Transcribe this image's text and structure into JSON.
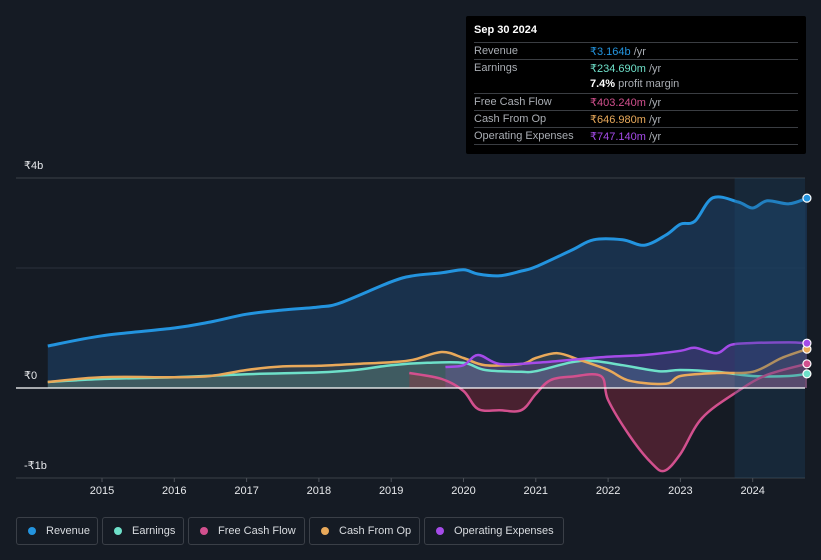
{
  "tooltip": {
    "date": "Sep 30 2024",
    "rows": [
      {
        "label": "Revenue",
        "value": "₹3.164b",
        "unit": " /yr",
        "color": "#2394df"
      },
      {
        "label": "Earnings",
        "value": "₹234.690m",
        "unit": " /yr",
        "color": "#6ee0c9"
      },
      {
        "label": "",
        "value": "7.4%",
        "unit": " profit margin",
        "color": "#ffffff"
      },
      {
        "label": "Free Cash Flow",
        "value": "₹403.240m",
        "unit": " /yr",
        "color": "#d2508e"
      },
      {
        "label": "Cash From Op",
        "value": "₹646.980m",
        "unit": " /yr",
        "color": "#e9a95a"
      },
      {
        "label": "Operating Expenses",
        "value": "₹747.140m",
        "unit": " /yr",
        "color": "#a54be9"
      }
    ]
  },
  "legend": [
    {
      "label": "Revenue",
      "color": "#2394df"
    },
    {
      "label": "Earnings",
      "color": "#6ee0c9"
    },
    {
      "label": "Free Cash Flow",
      "color": "#d2508e"
    },
    {
      "label": "Cash From Op",
      "color": "#e9a95a"
    },
    {
      "label": "Operating Expenses",
      "color": "#a54be9"
    }
  ],
  "chart_data": {
    "type": "area",
    "title": "",
    "xlabel": "",
    "ylabel": "",
    "y_tick_labels": [
      "₹4b",
      "₹0",
      "-₹1b"
    ],
    "x_tick_labels": [
      "2015",
      "2016",
      "2017",
      "2018",
      "2019",
      "2020",
      "2021",
      "2022",
      "2023",
      "2024"
    ],
    "x_ticks": [
      2015,
      2016,
      2017,
      2018,
      2019,
      2020,
      2021,
      2022,
      2023,
      2024
    ],
    "xlim": [
      2014.25,
      2024.75
    ],
    "ylim": [
      -1.5,
      3.5
    ],
    "units": "₹ billions",
    "highlight_start": 2023.75,
    "grid": true,
    "legend_position": "bottom",
    "series": [
      {
        "name": "Revenue",
        "color": "#2394df",
        "x": [
          2014.25,
          2015,
          2016,
          2016.5,
          2017,
          2017.5,
          2018,
          2018.3,
          2019,
          2019.3,
          2019.7,
          2020,
          2020.2,
          2020.5,
          2020.8,
          2021,
          2021.5,
          2021.8,
          2022.2,
          2022.5,
          2022.8,
          2023,
          2023.2,
          2023.45,
          2023.8,
          2024,
          2024.2,
          2024.5,
          2024.75
        ],
        "y": [
          0.7,
          0.87,
          1.0,
          1.1,
          1.23,
          1.3,
          1.35,
          1.42,
          1.77,
          1.87,
          1.92,
          1.97,
          1.9,
          1.87,
          1.95,
          2.02,
          2.3,
          2.47,
          2.47,
          2.38,
          2.55,
          2.73,
          2.78,
          3.17,
          3.1,
          3.0,
          3.12,
          3.07,
          3.164
        ]
      },
      {
        "name": "Earnings",
        "color": "#6ee0c9",
        "x": [
          2014.25,
          2015,
          2016,
          2017,
          2018,
          2018.5,
          2019,
          2019.5,
          2020,
          2020.3,
          2020.8,
          2021,
          2021.5,
          2021.8,
          2022.2,
          2022.7,
          2023,
          2023.5,
          2024,
          2024.5,
          2024.75
        ],
        "y": [
          0.1,
          0.15,
          0.18,
          0.23,
          0.26,
          0.3,
          0.38,
          0.42,
          0.42,
          0.3,
          0.27,
          0.28,
          0.43,
          0.45,
          0.38,
          0.28,
          0.3,
          0.27,
          0.2,
          0.2,
          0.235
        ]
      },
      {
        "name": "Free Cash Flow",
        "color": "#d2508e",
        "x": [
          2019.25,
          2019.7,
          2020,
          2020.2,
          2020.5,
          2020.8,
          2021,
          2021.2,
          2021.5,
          2021.9,
          2022,
          2022.3,
          2022.6,
          2022.78,
          2023,
          2023.3,
          2023.8,
          2024.2,
          2024.75
        ],
        "y": [
          0.25,
          0.15,
          -0.05,
          -0.35,
          -0.37,
          -0.37,
          -0.1,
          0.13,
          0.19,
          0.2,
          -0.2,
          -0.8,
          -1.25,
          -1.38,
          -1.1,
          -0.5,
          -0.05,
          0.22,
          0.403
        ]
      },
      {
        "name": "Cash From Op",
        "color": "#e9a95a",
        "x": [
          2014.25,
          2015,
          2016,
          2016.5,
          2017,
          2017.5,
          2018,
          2018.5,
          2019,
          2019.3,
          2019.7,
          2020,
          2020.3,
          2020.8,
          2021,
          2021.3,
          2021.6,
          2022,
          2022.3,
          2022.8,
          2023,
          2023.5,
          2024,
          2024.4,
          2024.75
        ],
        "y": [
          0.1,
          0.18,
          0.18,
          0.2,
          0.3,
          0.36,
          0.37,
          0.4,
          0.43,
          0.47,
          0.6,
          0.5,
          0.38,
          0.4,
          0.5,
          0.58,
          0.47,
          0.3,
          0.12,
          0.07,
          0.2,
          0.25,
          0.27,
          0.5,
          0.647
        ]
      },
      {
        "name": "Operating Expenses",
        "color": "#a54be9",
        "x": [
          2019.75,
          2020,
          2020.2,
          2020.5,
          2021,
          2021.5,
          2022,
          2022.5,
          2023,
          2023.2,
          2023.5,
          2023.7,
          2024,
          2024.5,
          2024.75
        ],
        "y": [
          0.35,
          0.38,
          0.55,
          0.4,
          0.42,
          0.47,
          0.52,
          0.55,
          0.62,
          0.67,
          0.58,
          0.72,
          0.75,
          0.76,
          0.747
        ]
      }
    ]
  }
}
